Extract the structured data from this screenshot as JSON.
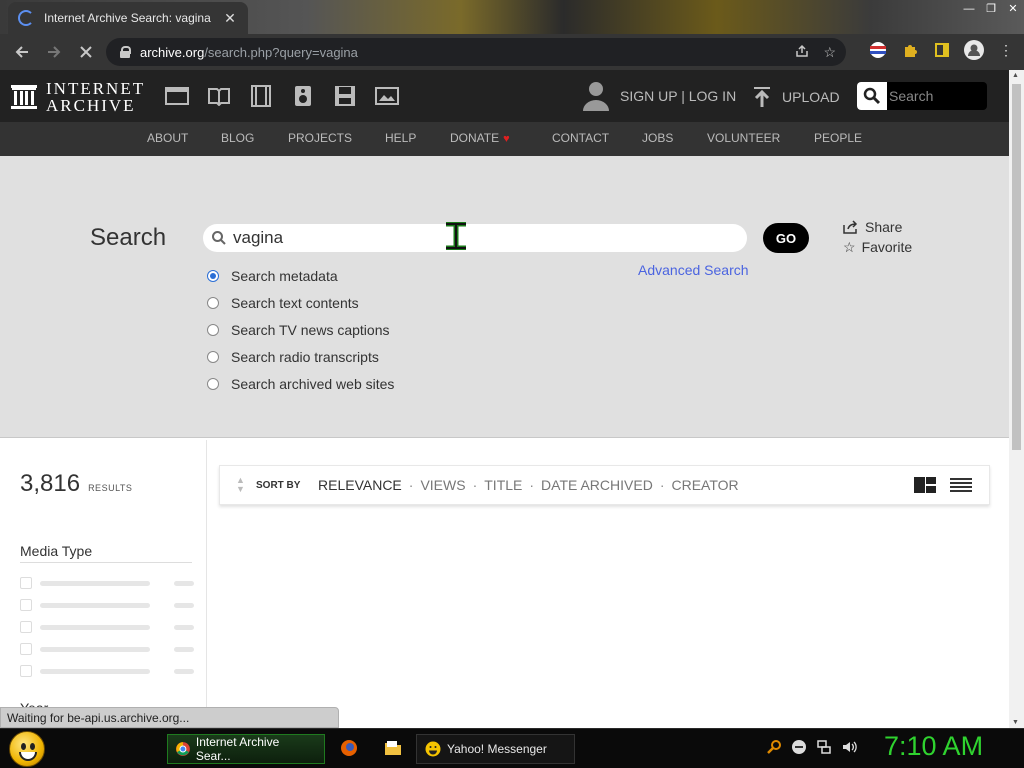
{
  "browser": {
    "tab_title": "Internet Archive Search: vagina",
    "tab_close": "✕",
    "url_host": "archive.org",
    "url_path": "/search.php?query=vagina"
  },
  "header": {
    "logo_line1": "INTERNET",
    "logo_line2": "ARCHIVE",
    "signup_login": "SIGN UP | LOG IN",
    "upload": "UPLOAD",
    "search_placeholder": "Search"
  },
  "nav": {
    "items": [
      "ABOUT",
      "BLOG",
      "PROJECTS",
      "HELP",
      "DONATE",
      "CONTACT",
      "JOBS",
      "VOLUNTEER",
      "PEOPLE"
    ]
  },
  "hero": {
    "title": "Search",
    "query": "vagina",
    "go_label": "GO",
    "advanced_search": "Advanced Search",
    "share": "Share",
    "favorite": "Favorite",
    "options": [
      {
        "label": "Search metadata",
        "checked": true
      },
      {
        "label": "Search text contents",
        "checked": false
      },
      {
        "label": "Search TV news captions",
        "checked": false
      },
      {
        "label": "Search radio transcripts",
        "checked": false
      },
      {
        "label": "Search archived web sites",
        "checked": false
      }
    ]
  },
  "results": {
    "count": "3,816",
    "count_label": "RESULTS",
    "facet_title": "Media Type",
    "next_facet_peek": "Year",
    "sort_label": "SORT BY",
    "sort_options": [
      "RELEVANCE",
      "VIEWS",
      "TITLE",
      "DATE ARCHIVED",
      "CREATOR"
    ],
    "sort_separator": "·",
    "active_sort": "RELEVANCE"
  },
  "status_text": "Waiting for be-api.us.archive.org...",
  "taskbar": {
    "tasks": [
      {
        "label": "Internet Archive Sear...",
        "icon": "chrome-icon",
        "active": true
      },
      {
        "label": "Yahoo! Messenger",
        "icon": "yahoo-messenger-icon",
        "active": false
      }
    ],
    "clock": "7:10 AM"
  },
  "colors": {
    "accent_link": "#4b64e0",
    "clock_green": "#2fd32f",
    "donate_heart": "#e02020"
  }
}
